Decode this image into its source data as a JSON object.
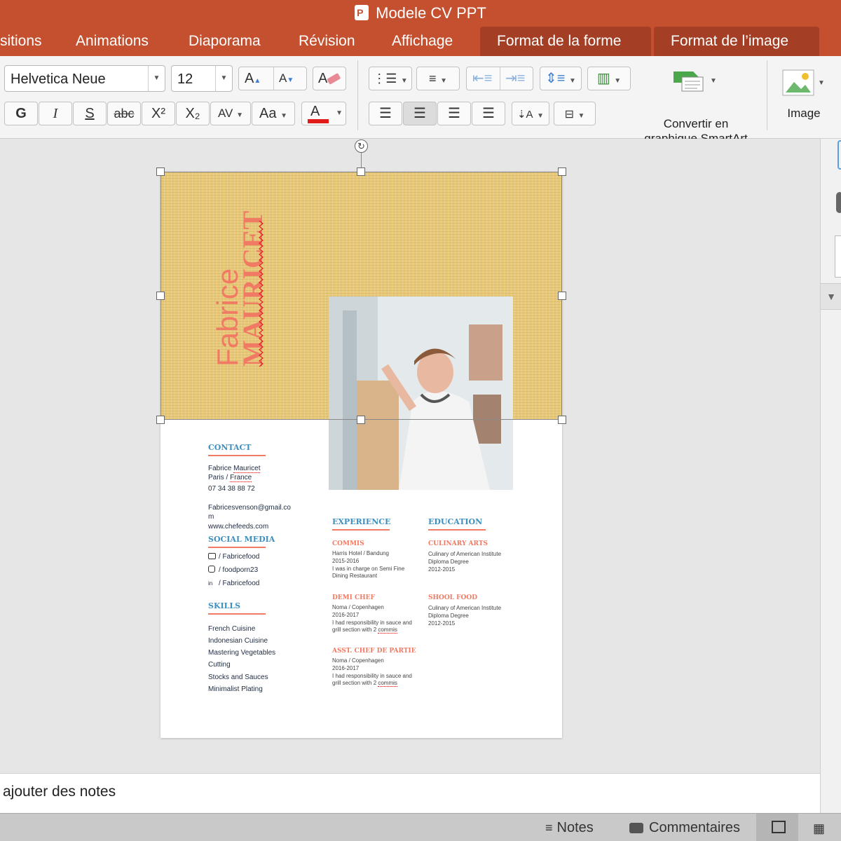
{
  "window": {
    "title": "Modele CV PPT"
  },
  "tabs": [
    {
      "label": "sitions"
    },
    {
      "label": "Animations"
    },
    {
      "label": "Diaporama"
    },
    {
      "label": "Révision"
    },
    {
      "label": "Affichage"
    },
    {
      "label": "Format de la forme"
    },
    {
      "label": "Format de l’image"
    }
  ],
  "ribbon": {
    "font_name": "Helvetica Neue",
    "font_size": "12",
    "bold": "G",
    "italic": "I",
    "underline": "S",
    "strike": "abc",
    "superscript": "X²",
    "subscript": "X₂",
    "spacing": "AV",
    "case": "Aa",
    "font_color_label": "A",
    "grow": "A",
    "shrink": "A",
    "smartart_label_1": "Convertir en",
    "smartart_label_2": "graphique SmartArt",
    "image_label": "Image",
    "font_color": "#e11a1a"
  },
  "cv": {
    "first_name": "Fabrice",
    "last_name": "MAURICET",
    "contact_h": "CONTACT",
    "contact_name_1": "Fabrice ",
    "contact_name_2": "Mauricet",
    "contact_city_1": "Paris / ",
    "contact_city_2": "France",
    "contact_phone": "07 34 38 88 72",
    "contact_email_1": "Fabricesvenson@gmail.co",
    "contact_email_2": "m",
    "contact_web": "www.chefeeds.com",
    "social_h": "SOCIAL MEDIA",
    "social": [
      {
        "text": "/ Fabricefood"
      },
      {
        "text": "/ foodporn23"
      },
      {
        "text": "/ Fabricefood"
      }
    ],
    "skills_h": "SKILLS",
    "skills": [
      {
        "text": "French Cuisine"
      },
      {
        "text": "Indonesian Cuisine"
      },
      {
        "text": "Mastering Vegetables"
      },
      {
        "text": "Cutting"
      },
      {
        "text": "Stocks and Sauces"
      },
      {
        "text": "Minimalist Plating"
      }
    ],
    "experience_h": "EXPERIENCE",
    "education_h": "EDUCATION",
    "exp": [
      {
        "title": "COMMIS",
        "l1": "Harris Hotel / Bandung",
        "l2": "2015-2016",
        "l3": "I was in charge on Semi Fine",
        "l4": "Dining Restaurant"
      },
      {
        "title": "DEMI CHEF",
        "l1": "Noma / Copenhagen",
        "l2": "2016-2017",
        "l3": "I had responsibility in sauce and",
        "l4a": "grill section with 2 ",
        "l4b": "commis"
      },
      {
        "title": "ASST. CHEF DE PARTIE",
        "l1": "Noma / Copenhagen",
        "l2": "2016-2017",
        "l3": "I had responsibility in sauce and",
        "l4a": "grill section with 2 ",
        "l4b": "commis"
      }
    ],
    "edu": [
      {
        "title": "CULINARY ARTS",
        "l1": "Culinary of American Institute",
        "l2": "Diploma Degree",
        "l3": "2012-2015"
      },
      {
        "title": "SHOOL FOOD",
        "l1": "Culinary of American Institute",
        "l2": "Diploma Degree",
        "l3": "2012-2015"
      }
    ]
  },
  "notes": {
    "placeholder": "ajouter des notes"
  },
  "status": {
    "notes": "Notes",
    "comments": "Commentaires"
  }
}
